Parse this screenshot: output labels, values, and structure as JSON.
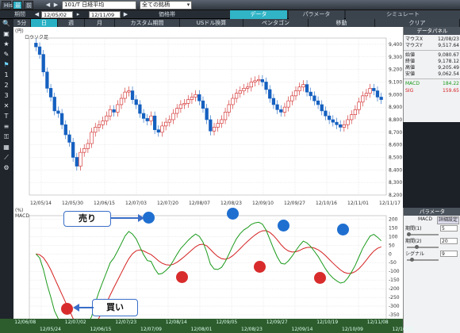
{
  "toolbar": {
    "mini_labels": [
      "Hist",
      "最新",
      "前"
    ],
    "symbol": "101/T 日経平均",
    "category": "全ての銘柄",
    "btn_extra": ""
  },
  "bar2": {
    "period_label": "期間",
    "date_from": "12/05/02",
    "date_to": "12/11/09",
    "price_type": "価格帯",
    "tab_data": "データ",
    "tab_param": "パラメータ",
    "tab_sim": "シミュレート"
  },
  "tabs": [
    {
      "label": "5分",
      "active": false
    },
    {
      "label": "日",
      "active": true
    },
    {
      "label": "週",
      "active": false
    },
    {
      "label": "月",
      "active": false
    },
    {
      "label": "カスタム期間",
      "active": false
    },
    {
      "label": "USドル換算",
      "active": false
    },
    {
      "label": "ペンタゴン",
      "active": false
    },
    {
      "label": "移動",
      "active": false
    },
    {
      "label": "クリア",
      "active": false
    }
  ],
  "chart": {
    "upper_unit": "(円)",
    "upper_title": "ロウソク足",
    "lower_unit": "(%)",
    "lower_title": "MACD",
    "price_ticks": [
      "9,400",
      "9,300",
      "9,200",
      "9,100",
      "9,000",
      "8,900",
      "8,800",
      "8,700",
      "8,600",
      "8,500",
      "8,400",
      "8,300",
      "8,200"
    ],
    "macd_ticks": [
      "200",
      "150",
      "100",
      "50",
      "0",
      "-50",
      "-100",
      "-150",
      "-200",
      "-250",
      "-300",
      "-350",
      "-400"
    ],
    "date_ticks": [
      "12/05/14",
      "12/05/30",
      "12/06/15",
      "12/07/03",
      "12/07/20",
      "12/08/07",
      "12/08/23",
      "12/09/10",
      "12/09/27",
      "12/10/16",
      "12/11/01",
      "12/11/17"
    ],
    "sell_label": "売り",
    "buy_label": "買い",
    "sell_color": "#1f6fd0",
    "buy_color": "#d82c2c"
  },
  "chart_data": {
    "type": "line",
    "title": "ロウソク足",
    "candles_close": [
      9380,
      9320,
      9180,
      9050,
      8980,
      8870,
      8850,
      8760,
      8680,
      8620,
      8500,
      8430,
      8540,
      8570,
      8610,
      8700,
      8740,
      8760,
      8790,
      8830,
      8880,
      8860,
      8920,
      8970,
      9020,
      9030,
      8960,
      8920,
      8850,
      8810,
      8790,
      8830,
      8720,
      8700,
      8750,
      8780,
      8800,
      8850,
      8890,
      8920,
      8930,
      8960,
      8980,
      9000,
      8950,
      8890,
      8800,
      8710,
      8740,
      8770,
      8800,
      8860,
      8920,
      8970,
      9010,
      9030,
      9050,
      9060,
      9100,
      9110,
      9120,
      9100,
      9040,
      8970,
      8920,
      8880,
      8860,
      8900,
      8950,
      8990,
      9030,
      9060,
      9080,
      9020,
      8990,
      8950,
      8920,
      8870,
      8830,
      8800,
      8780,
      8760,
      8740,
      8760,
      8800,
      8840,
      8880,
      8940,
      8990,
      9010,
      9050,
      9030,
      8980,
      8960
    ],
    "macd_series": [
      {
        "name": "MACD",
        "color": "#1a9a1a"
      },
      {
        "name": "SIG",
        "color": "#d42020"
      }
    ],
    "price_ylim": [
      8200,
      9450
    ],
    "macd_ylim": [
      -400,
      220
    ]
  },
  "infopanel": {
    "header": "データパネル",
    "rows": [
      {
        "k": "マウスX",
        "v": "12/08/23"
      },
      {
        "k": "マウスY",
        "v": "9,517.64"
      },
      {
        "k": "始値",
        "v": "9,080.67"
      },
      {
        "k": "終値",
        "v": "9,178.12"
      },
      {
        "k": "高値",
        "v": "9,205.49"
      },
      {
        "k": "安値",
        "v": "9,062.54"
      }
    ],
    "macd_key": "MACD",
    "macd_val": "184.22",
    "sig_key": "SIG",
    "sig_val": "159.65"
  },
  "parampanel": {
    "header": "パラメータ",
    "sub_title": "MACD",
    "sub_btn": "詳細設定",
    "rows": [
      {
        "k": "期間(1)",
        "v": "5"
      },
      {
        "k": "期間(2)",
        "v": "20"
      },
      {
        "k": "シグナル",
        "v": "9"
      }
    ]
  },
  "datestrip": {
    "top": [
      "12/06/08",
      "12/07/02",
      "12/07/23",
      "12/08/14",
      "12/09/05",
      "12/09/27",
      "12/10/19",
      "12/11/08"
    ],
    "bottom": [
      "12/05/24",
      "12/06/15",
      "12/07/09",
      "12/08/01",
      "12/08/23",
      "12/09/14",
      "12/10/09",
      "12/10/31"
    ]
  }
}
